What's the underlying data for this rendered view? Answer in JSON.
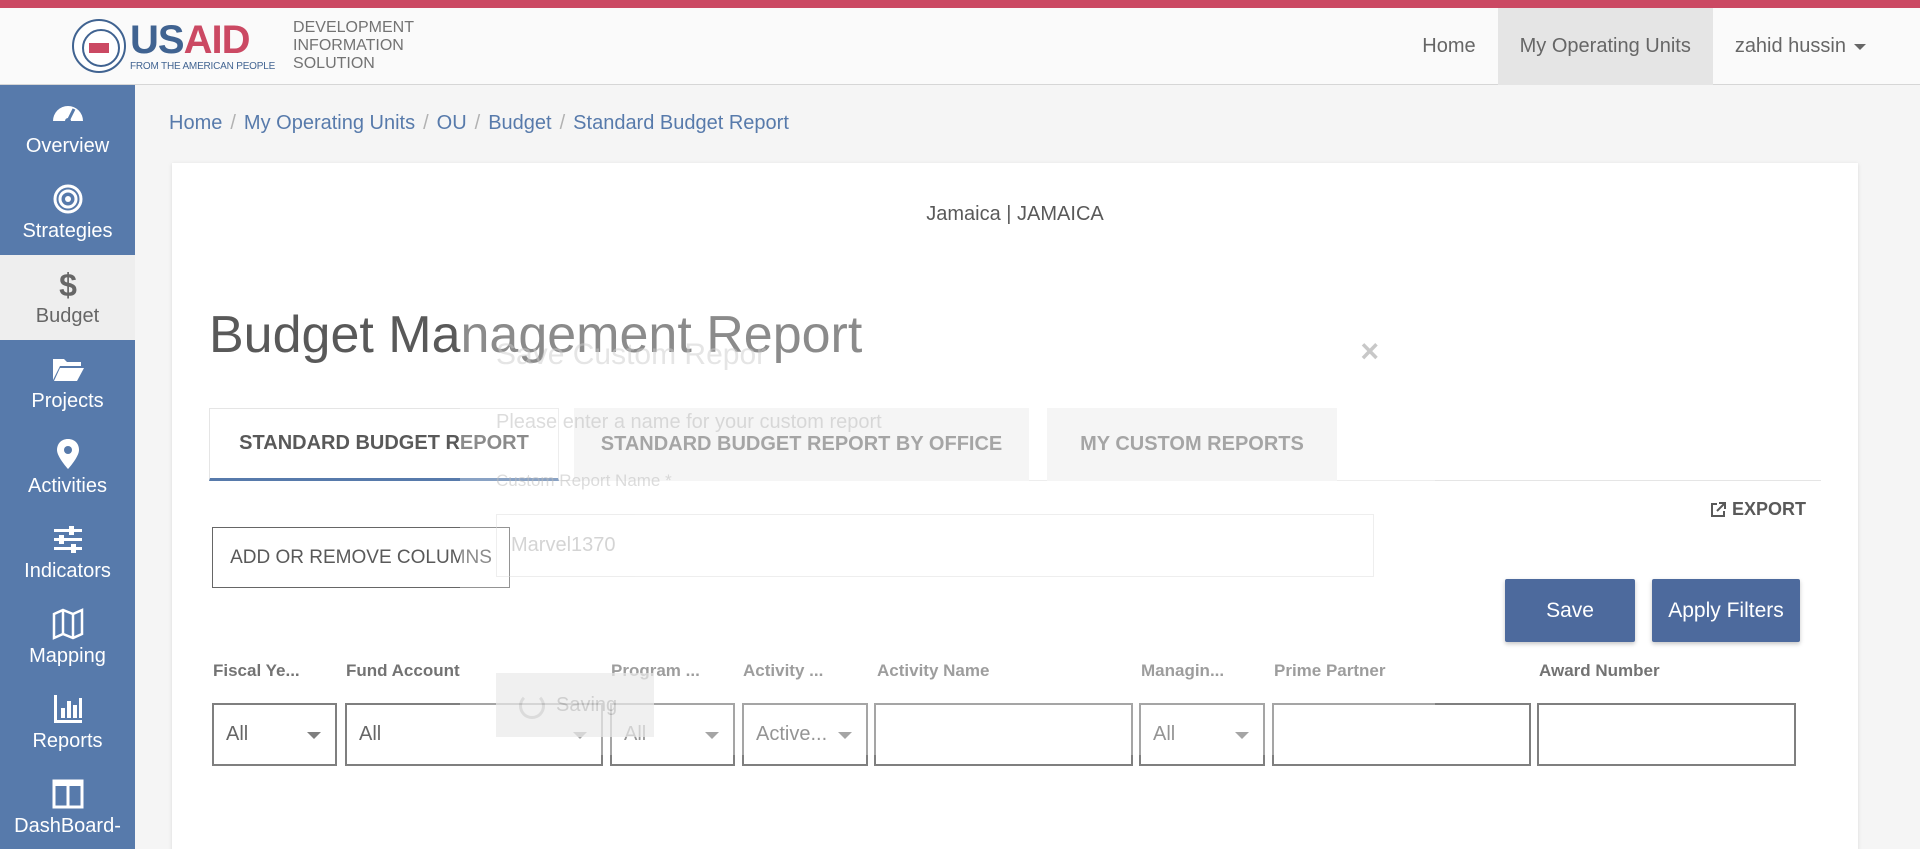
{
  "header": {
    "logo": {
      "us": "US",
      "aid": "AID",
      "tagline": "FROM THE AMERICAN PEOPLE",
      "app_line1": "DEVELOPMENT",
      "app_line2": "INFORMATION",
      "app_line3": "SOLUTION"
    },
    "nav": [
      {
        "label": "Home"
      },
      {
        "label": "My Operating Units"
      },
      {
        "label": "zahid hussin"
      }
    ]
  },
  "sidebar": {
    "items": [
      {
        "label": "Overview",
        "icon": "gauge-icon"
      },
      {
        "label": "Strategies",
        "icon": "target-icon"
      },
      {
        "label": "Budget",
        "icon": "dollar-icon"
      },
      {
        "label": "Projects",
        "icon": "folder-icon"
      },
      {
        "label": "Activities",
        "icon": "map-marker-icon"
      },
      {
        "label": "Indicators",
        "icon": "sliders-icon"
      },
      {
        "label": "Mapping",
        "icon": "map-icon"
      },
      {
        "label": "Reports",
        "icon": "bar-chart-icon"
      },
      {
        "label": "DashBoard-",
        "icon": "columns-icon"
      }
    ]
  },
  "breadcrumb": [
    "Home",
    "My Operating Units",
    "OU",
    "Budget",
    "Standard Budget Report"
  ],
  "main": {
    "ou_title": "Jamaica | JAMAICA",
    "report_title": "Budget Management Report",
    "tabs": [
      {
        "label": "STANDARD BUDGET REPORT"
      },
      {
        "label": "STANDARD BUDGET REPORT BY OFFICE"
      },
      {
        "label": "MY CUSTOM REPORTS"
      }
    ],
    "export_label": "EXPORT",
    "add_columns_label": "ADD OR REMOVE COLUMNS",
    "save_label": "Save",
    "apply_label": "Apply Filters",
    "filters": [
      {
        "label": "Fiscal Ye...",
        "value": "All"
      },
      {
        "label": "Fund Account",
        "value": "All"
      },
      {
        "label": "Program ...",
        "value": "All"
      },
      {
        "label": "Activity ...",
        "value": "Active..."
      },
      {
        "label": "Activity Name",
        "value": ""
      },
      {
        "label": "Managin...",
        "value": "All"
      },
      {
        "label": "Prime Partner",
        "value": ""
      },
      {
        "label": "Award Number",
        "value": ""
      }
    ]
  },
  "modal": {
    "title": "Save Custom Repor",
    "hint": "Please enter a name for your custom report",
    "field_label": "Custom Report Name *",
    "field_value": "Marvel1370",
    "save_label": "Saving",
    "close": "×"
  }
}
